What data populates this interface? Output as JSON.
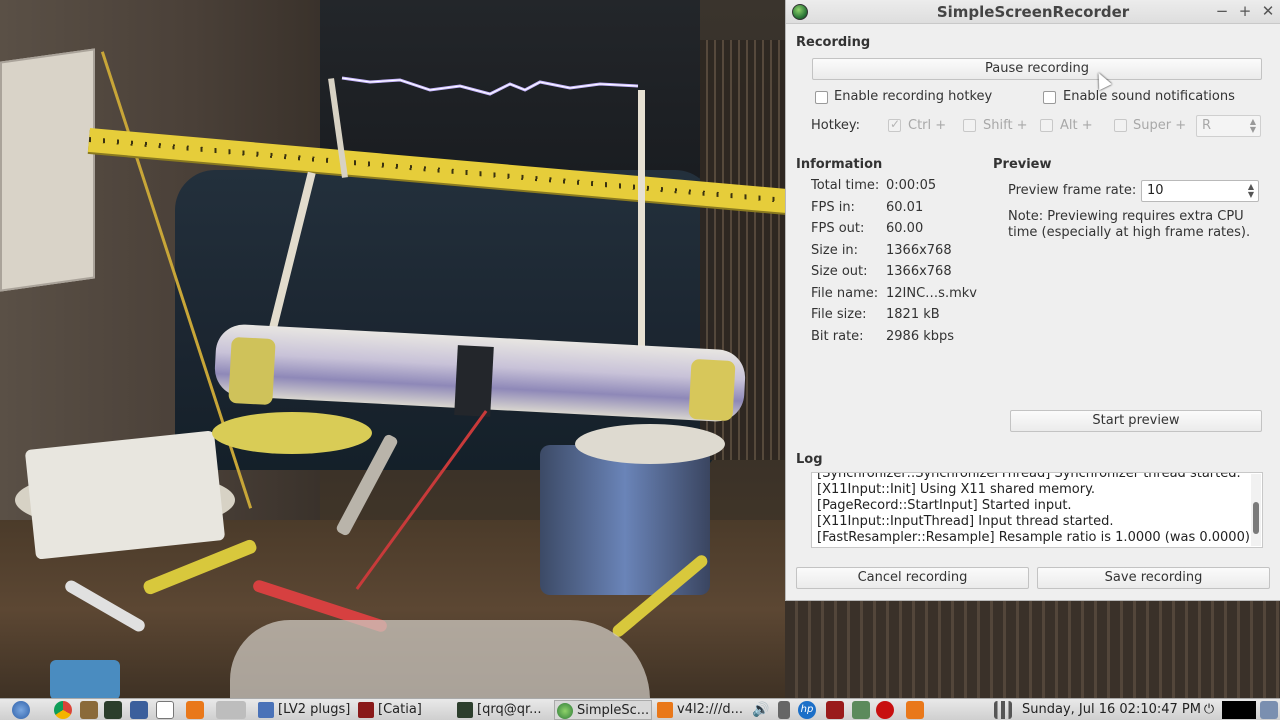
{
  "window": {
    "title": "SimpleScreenRecorder",
    "controls": {
      "minimize": "−",
      "maximize": "+",
      "close": "✕"
    }
  },
  "recording": {
    "heading": "Recording",
    "pause_button": "Pause recording",
    "enable_hotkey_label": "Enable recording hotkey",
    "enable_sound_label": "Enable sound notifications",
    "hotkey_label": "Hotkey:",
    "modifiers": {
      "ctrl": "Ctrl +",
      "shift": "Shift +",
      "alt": "Alt +",
      "super": "Super +"
    },
    "key_value": "R"
  },
  "information": {
    "heading": "Information",
    "rows": [
      {
        "label": "Total time:",
        "value": "0:00:05"
      },
      {
        "label": "FPS in:",
        "value": "60.01"
      },
      {
        "label": "FPS out:",
        "value": "60.00"
      },
      {
        "label": "Size in:",
        "value": "1366x768"
      },
      {
        "label": "Size out:",
        "value": "1366x768"
      },
      {
        "label": "File name:",
        "value": "12INC…s.mkv"
      },
      {
        "label": "File size:",
        "value": "1821 kB"
      },
      {
        "label": "Bit rate:",
        "value": "2986 kbps"
      }
    ]
  },
  "preview": {
    "heading": "Preview",
    "frame_rate_label": "Preview frame rate:",
    "frame_rate_value": "10",
    "note": "Note: Previewing requires extra CPU time (especially at high frame rates).",
    "start_button": "Start preview"
  },
  "log": {
    "heading": "Log",
    "lines": [
      "[Synchronizer::SynchronizerThread] Synchronizer thread started.",
      "[X11Input::Init] Using X11 shared memory.",
      "[PageRecord::StartInput] Started input.",
      "[X11Input::InputThread] Input thread started.",
      "[FastResampler::Resample] Resample ratio is 1.0000 (was 0.0000)."
    ]
  },
  "footer": {
    "cancel_button": "Cancel recording",
    "save_button": "Save recording"
  },
  "taskbar": {
    "tasks": [
      "[LV2 plugs]",
      "[Catia]",
      "[qrq@qr...",
      "SimpleSc...",
      "v4l2:///d..."
    ],
    "clock": "Sunday, Jul 16 02:10:47 PM"
  }
}
